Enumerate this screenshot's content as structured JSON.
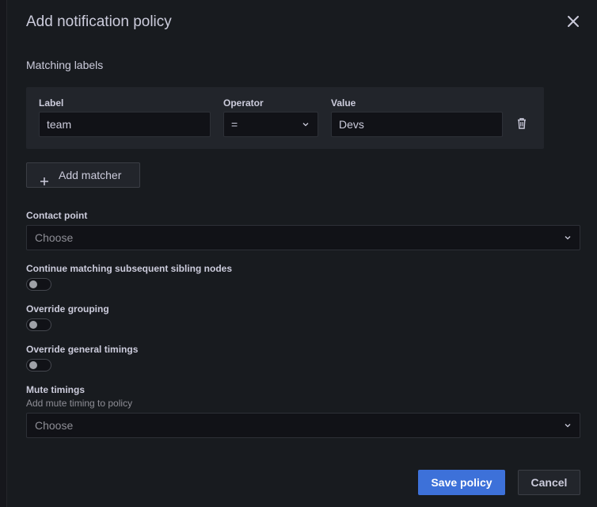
{
  "dialog": {
    "title": "Add notification policy",
    "close_icon": "close-icon"
  },
  "matching_labels": {
    "section_title": "Matching labels",
    "label_header": "Label",
    "operator_header": "Operator",
    "value_header": "Value",
    "matchers": [
      {
        "label": "team",
        "operator": "=",
        "value": "Devs"
      }
    ],
    "delete_icon": "trash-icon",
    "add_matcher_label": "Add matcher",
    "add_icon": "plus-icon"
  },
  "contact_point": {
    "label": "Contact point",
    "placeholder": "Choose"
  },
  "toggles": {
    "continue_matching": {
      "label": "Continue matching subsequent sibling nodes",
      "checked": false
    },
    "override_grouping": {
      "label": "Override grouping",
      "checked": false
    },
    "override_timings": {
      "label": "Override general timings",
      "checked": false
    }
  },
  "mute_timings": {
    "label": "Mute timings",
    "description": "Add mute timing to policy",
    "placeholder": "Choose"
  },
  "footer": {
    "save_label": "Save policy",
    "cancel_label": "Cancel"
  },
  "colors": {
    "background": "#181b1f",
    "panel": "#22252b",
    "input_bg": "#111217",
    "primary": "#3d71d9",
    "text": "#ccccdc",
    "muted_text": "#8e8e96"
  }
}
